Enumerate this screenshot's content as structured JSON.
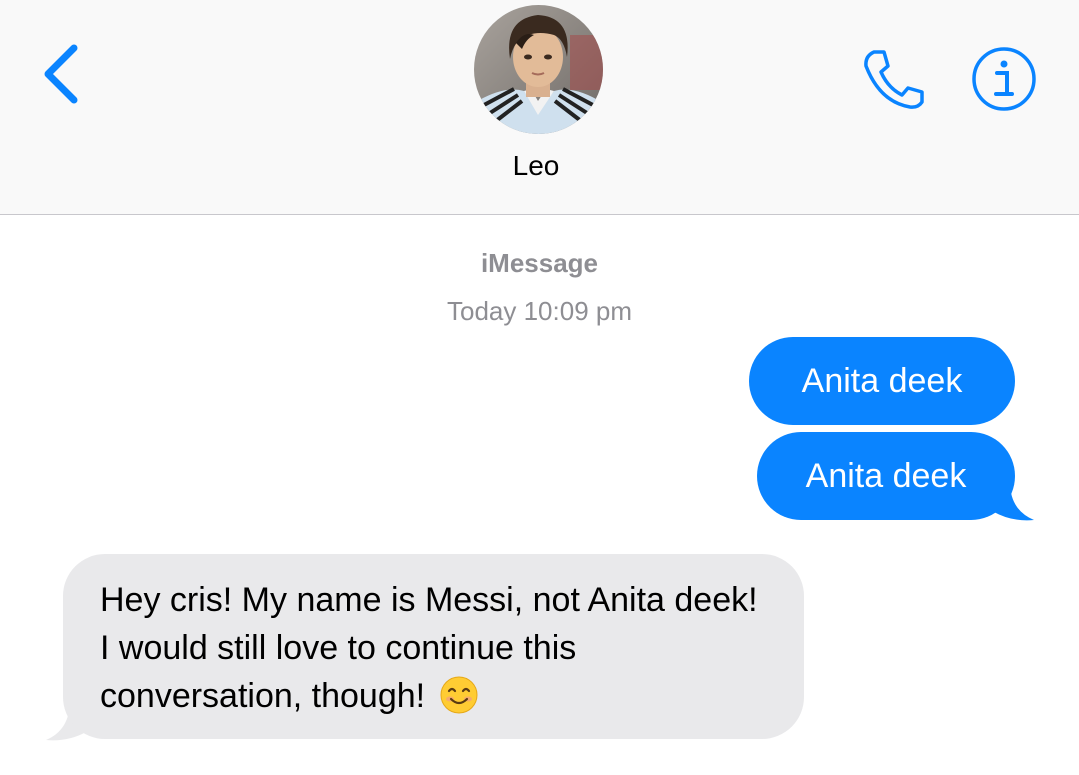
{
  "header": {
    "contact_name": "Leo",
    "back_icon": "chevron-left-icon",
    "call_icon": "phone-icon",
    "info_icon": "info-icon"
  },
  "thread": {
    "service": "iMessage",
    "timestamp": "Today 10:09 pm",
    "messages": [
      {
        "direction": "sent",
        "text": "Anita deek"
      },
      {
        "direction": "sent",
        "text": "Anita deek"
      },
      {
        "direction": "received",
        "text": "Hey cris! My name is Messi, not Anita deek! I would still love to continue this conversation, though!",
        "emoji": "smiling-face-emoji"
      }
    ]
  },
  "colors": {
    "accent": "#0a84ff",
    "sent_bubble": "#0a84ff",
    "received_bubble": "#e9e9eb",
    "meta_text": "#8e8e93",
    "header_bg": "#f9f9f9"
  }
}
